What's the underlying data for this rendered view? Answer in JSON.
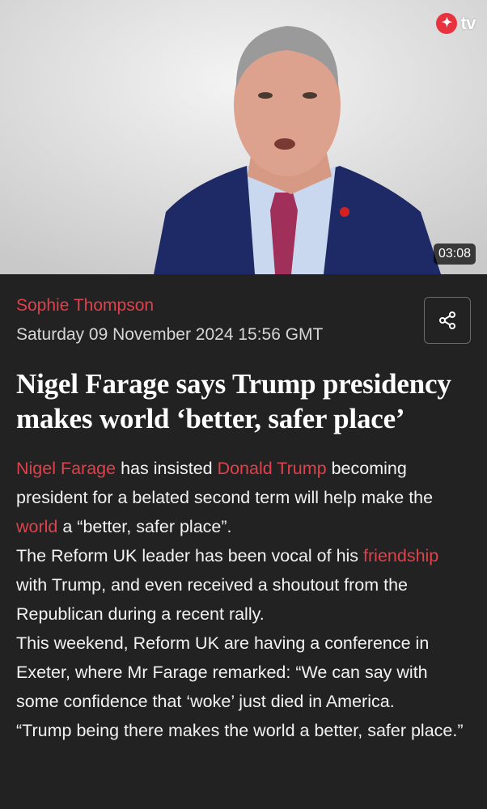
{
  "video": {
    "logo_text": "tv",
    "logo_icon": "eagle-icon",
    "duration": "03:08"
  },
  "article": {
    "author": "Sophie Thompson",
    "date": "Saturday 09 November 2024 15:56 GMT",
    "headline": "Nigel Farage says Trump presidency makes world ‘better, safer place’",
    "p1": {
      "link1": "Nigel Farage",
      "t1": " has insisted ",
      "link2": "Donald Trump",
      "t2": " becoming president for a belated second term will help make the ",
      "link3": "world",
      "t3": " a “better, safer place”."
    },
    "p2": {
      "t1": "The Reform UK leader has been vocal of his ",
      "link1": "friendship",
      "t2": " with Trump, and even received a shoutout from the Republican during a recent rally."
    },
    "p3": "This weekend, Reform UK are having a conference in Exeter, where Mr Farage remarked: “We can say with some confidence that ‘woke’ just died in America.",
    "p4": "“Trump being there makes the world a better, safer place.”"
  },
  "colors": {
    "accent": "#e0414b",
    "background": "#222222",
    "text": "#f2f2f2"
  },
  "icons": {
    "share": "share-icon"
  }
}
